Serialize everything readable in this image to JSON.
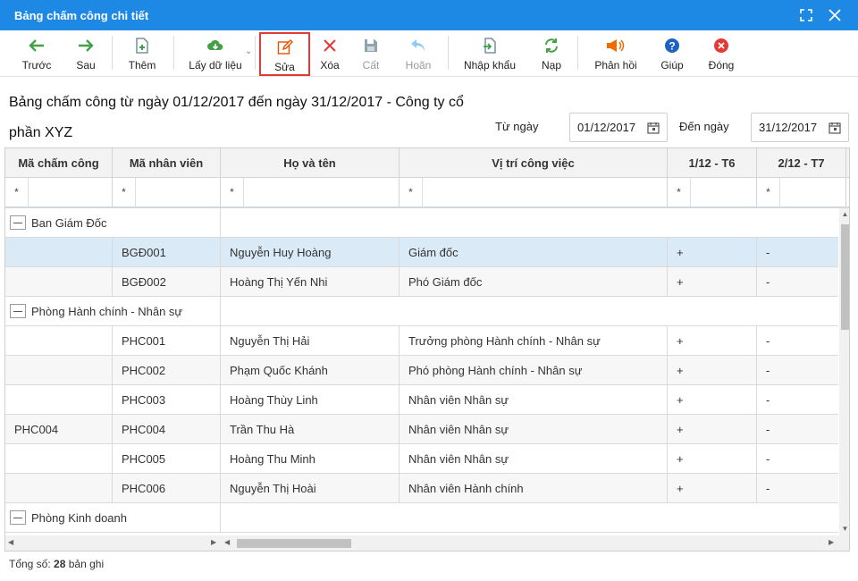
{
  "window": {
    "title": "Bảng chấm công chi tiết"
  },
  "toolbar": {
    "prev": "Trước",
    "next": "Sau",
    "add": "Thêm",
    "fetch": "Lấy dữ liệu",
    "edit": "Sửa",
    "delete": "Xóa",
    "save": "Cất",
    "undo": "Hoãn",
    "import": "Nhập khẩu",
    "reload": "Nạp",
    "feedback": "Phản hồi",
    "help": "Giúp",
    "close": "Đóng"
  },
  "colors": {
    "titlebar": "#1e88e5",
    "selected_row": "#dbeaf7",
    "highlight_border": "#e53935"
  },
  "headline": "Bảng chấm công từ ngày 01/12/2017 đến ngày 31/12/2017 - Công ty cổ phần XYZ",
  "filters": {
    "from_label": "Từ ngày",
    "from_value": "01/12/2017",
    "to_label": "Đến ngày",
    "to_value": "31/12/2017"
  },
  "grid": {
    "columns": {
      "ma_cham_cong": "Mã chấm công",
      "ma_nhan_vien": "Mã nhân viên",
      "ho_ten": "Họ và tên",
      "vi_tri": "Vị trí công việc",
      "d1": "1/12 - T6",
      "d2": "2/12 - T7"
    },
    "filter_op": "*",
    "groups": [
      {
        "name": "Ban Giám Đốc",
        "rows": [
          {
            "ma_cc": "",
            "ma_nv": "BGĐ001",
            "ten": "Nguyễn Huy Hoàng",
            "vitri": "Giám đốc",
            "d1": "+",
            "d2": "-"
          },
          {
            "ma_cc": "",
            "ma_nv": "BGĐ002",
            "ten": "Hoàng Thị Yến Nhi",
            "vitri": "Phó Giám đốc",
            "d1": "+",
            "d2": "-"
          }
        ]
      },
      {
        "name": "Phòng Hành chính - Nhân sự",
        "rows": [
          {
            "ma_cc": "",
            "ma_nv": "PHC001",
            "ten": "Nguyễn Thị Hải",
            "vitri": "Trưởng phòng Hành chính - Nhân sự",
            "d1": "+",
            "d2": "-"
          },
          {
            "ma_cc": "",
            "ma_nv": "PHC002",
            "ten": "Phạm Quốc Khánh",
            "vitri": "Phó phòng Hành chính - Nhân sự",
            "d1": "+",
            "d2": "-"
          },
          {
            "ma_cc": "",
            "ma_nv": "PHC003",
            "ten": "Hoàng Thùy Linh",
            "vitri": "Nhân viên Nhân sự",
            "d1": "+",
            "d2": "-"
          },
          {
            "ma_cc": "PHC004",
            "ma_nv": "PHC004",
            "ten": "Trần Thu Hà",
            "vitri": "Nhân viên Nhân sự",
            "d1": "+",
            "d2": "-"
          },
          {
            "ma_cc": "",
            "ma_nv": "PHC005",
            "ten": "Hoàng Thu Minh",
            "vitri": "Nhân viên Nhân sự",
            "d1": "+",
            "d2": "-"
          },
          {
            "ma_cc": "",
            "ma_nv": "PHC006",
            "ten": "Nguyễn Thị Hoài",
            "vitri": "Nhân viên Hành chính",
            "d1": "+",
            "d2": "-"
          }
        ]
      },
      {
        "name": "Phòng Kinh doanh",
        "rows": []
      }
    ]
  },
  "footer": {
    "prefix": "Tổng số:",
    "count": "28",
    "suffix": "bản ghi"
  }
}
